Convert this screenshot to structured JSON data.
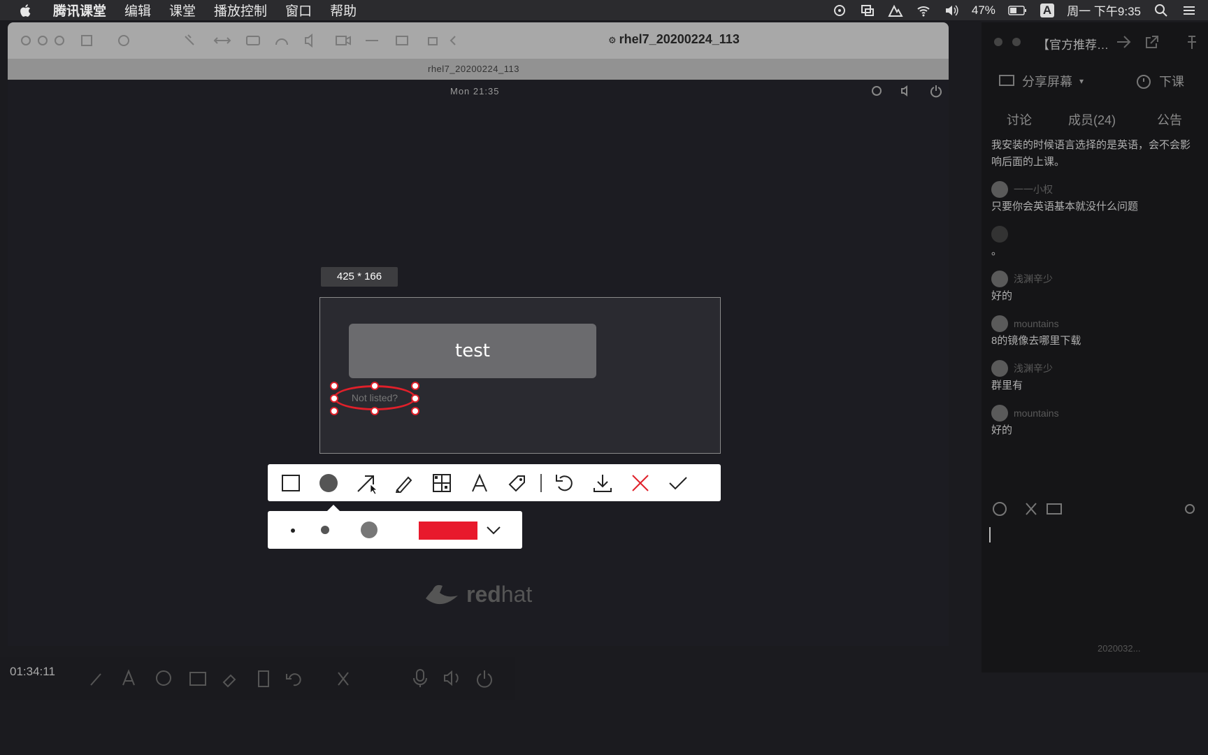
{
  "menubar": {
    "app_name": "腾讯课堂",
    "menus": [
      "编辑",
      "课堂",
      "播放控制",
      "窗口",
      "帮助"
    ],
    "battery": "47%",
    "input_method": "A",
    "datetime": "周一 下午9:35"
  },
  "vm": {
    "window_title": "rhel7_20200224_113",
    "tab_title": "rhel7_20200224_113",
    "clock": "Mon 21:35",
    "selection_size": "425 * 166",
    "test_button": "test",
    "not_listed": "Not listed?",
    "brand_red": "red",
    "brand_hat": "hat",
    "annotation_color": "#e8192c"
  },
  "annot_toolbar": {
    "tools": [
      "rectangle-tool",
      "ellipse-tool",
      "arrow-tool",
      "pen-tool",
      "mosaic-tool",
      "text-tool",
      "tag-tool",
      "undo",
      "download",
      "cancel",
      "confirm"
    ]
  },
  "bottom": {
    "timer": "01:34:11"
  },
  "panel": {
    "title": "【官方推荐…",
    "share_screen": "分享屏幕",
    "end_class": "下课",
    "tabs": [
      "讨论",
      "成员(24)",
      "公告"
    ],
    "messages": [
      {
        "user": "",
        "text": "我安装的时候语言选择的是英语，会不会影响后面的上课。"
      },
      {
        "user": "一一小权",
        "text": "只要你会英语基本就没什么问题"
      },
      {
        "user": "",
        "text": "。"
      },
      {
        "user": "浅渊辛少",
        "text": "好的"
      },
      {
        "user": "mountains",
        "text": "8的镜像去哪里下载"
      },
      {
        "user": "浅渊辛少",
        "text": "群里有"
      },
      {
        "user": "mountains",
        "text": "好的"
      }
    ],
    "footer": "2020032..."
  }
}
